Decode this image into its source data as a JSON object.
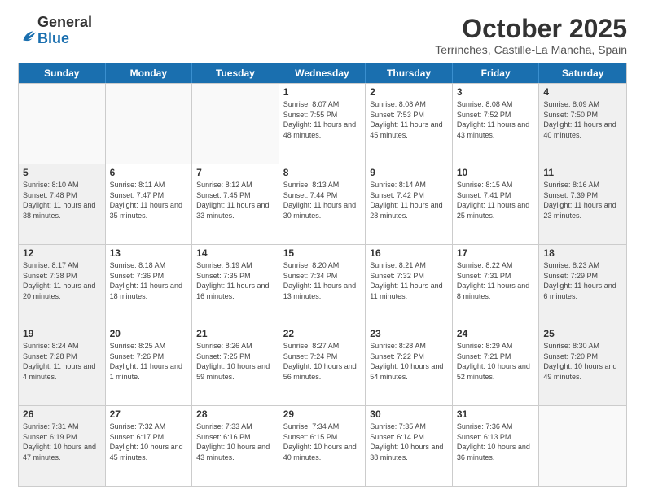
{
  "header": {
    "logo_general": "General",
    "logo_blue": "Blue",
    "month_title": "October 2025",
    "location": "Terrinches, Castille-La Mancha, Spain"
  },
  "days_of_week": [
    "Sunday",
    "Monday",
    "Tuesday",
    "Wednesday",
    "Thursday",
    "Friday",
    "Saturday"
  ],
  "weeks": [
    [
      {
        "day": "",
        "info": "",
        "empty": true
      },
      {
        "day": "",
        "info": "",
        "empty": true
      },
      {
        "day": "",
        "info": "",
        "empty": true
      },
      {
        "day": "1",
        "info": "Sunrise: 8:07 AM\nSunset: 7:55 PM\nDaylight: 11 hours\nand 48 minutes."
      },
      {
        "day": "2",
        "info": "Sunrise: 8:08 AM\nSunset: 7:53 PM\nDaylight: 11 hours\nand 45 minutes."
      },
      {
        "day": "3",
        "info": "Sunrise: 8:08 AM\nSunset: 7:52 PM\nDaylight: 11 hours\nand 43 minutes."
      },
      {
        "day": "4",
        "info": "Sunrise: 8:09 AM\nSunset: 7:50 PM\nDaylight: 11 hours\nand 40 minutes.",
        "shaded": true
      }
    ],
    [
      {
        "day": "5",
        "info": "Sunrise: 8:10 AM\nSunset: 7:48 PM\nDaylight: 11 hours\nand 38 minutes.",
        "shaded": true
      },
      {
        "day": "6",
        "info": "Sunrise: 8:11 AM\nSunset: 7:47 PM\nDaylight: 11 hours\nand 35 minutes."
      },
      {
        "day": "7",
        "info": "Sunrise: 8:12 AM\nSunset: 7:45 PM\nDaylight: 11 hours\nand 33 minutes."
      },
      {
        "day": "8",
        "info": "Sunrise: 8:13 AM\nSunset: 7:44 PM\nDaylight: 11 hours\nand 30 minutes."
      },
      {
        "day": "9",
        "info": "Sunrise: 8:14 AM\nSunset: 7:42 PM\nDaylight: 11 hours\nand 28 minutes."
      },
      {
        "day": "10",
        "info": "Sunrise: 8:15 AM\nSunset: 7:41 PM\nDaylight: 11 hours\nand 25 minutes."
      },
      {
        "day": "11",
        "info": "Sunrise: 8:16 AM\nSunset: 7:39 PM\nDaylight: 11 hours\nand 23 minutes.",
        "shaded": true
      }
    ],
    [
      {
        "day": "12",
        "info": "Sunrise: 8:17 AM\nSunset: 7:38 PM\nDaylight: 11 hours\nand 20 minutes.",
        "shaded": true
      },
      {
        "day": "13",
        "info": "Sunrise: 8:18 AM\nSunset: 7:36 PM\nDaylight: 11 hours\nand 18 minutes."
      },
      {
        "day": "14",
        "info": "Sunrise: 8:19 AM\nSunset: 7:35 PM\nDaylight: 11 hours\nand 16 minutes."
      },
      {
        "day": "15",
        "info": "Sunrise: 8:20 AM\nSunset: 7:34 PM\nDaylight: 11 hours\nand 13 minutes."
      },
      {
        "day": "16",
        "info": "Sunrise: 8:21 AM\nSunset: 7:32 PM\nDaylight: 11 hours\nand 11 minutes."
      },
      {
        "day": "17",
        "info": "Sunrise: 8:22 AM\nSunset: 7:31 PM\nDaylight: 11 hours\nand 8 minutes."
      },
      {
        "day": "18",
        "info": "Sunrise: 8:23 AM\nSunset: 7:29 PM\nDaylight: 11 hours\nand 6 minutes.",
        "shaded": true
      }
    ],
    [
      {
        "day": "19",
        "info": "Sunrise: 8:24 AM\nSunset: 7:28 PM\nDaylight: 11 hours\nand 4 minutes.",
        "shaded": true
      },
      {
        "day": "20",
        "info": "Sunrise: 8:25 AM\nSunset: 7:26 PM\nDaylight: 11 hours\nand 1 minute."
      },
      {
        "day": "21",
        "info": "Sunrise: 8:26 AM\nSunset: 7:25 PM\nDaylight: 10 hours\nand 59 minutes."
      },
      {
        "day": "22",
        "info": "Sunrise: 8:27 AM\nSunset: 7:24 PM\nDaylight: 10 hours\nand 56 minutes."
      },
      {
        "day": "23",
        "info": "Sunrise: 8:28 AM\nSunset: 7:22 PM\nDaylight: 10 hours\nand 54 minutes."
      },
      {
        "day": "24",
        "info": "Sunrise: 8:29 AM\nSunset: 7:21 PM\nDaylight: 10 hours\nand 52 minutes."
      },
      {
        "day": "25",
        "info": "Sunrise: 8:30 AM\nSunset: 7:20 PM\nDaylight: 10 hours\nand 49 minutes.",
        "shaded": true
      }
    ],
    [
      {
        "day": "26",
        "info": "Sunrise: 7:31 AM\nSunset: 6:19 PM\nDaylight: 10 hours\nand 47 minutes.",
        "shaded": true
      },
      {
        "day": "27",
        "info": "Sunrise: 7:32 AM\nSunset: 6:17 PM\nDaylight: 10 hours\nand 45 minutes."
      },
      {
        "day": "28",
        "info": "Sunrise: 7:33 AM\nSunset: 6:16 PM\nDaylight: 10 hours\nand 43 minutes."
      },
      {
        "day": "29",
        "info": "Sunrise: 7:34 AM\nSunset: 6:15 PM\nDaylight: 10 hours\nand 40 minutes."
      },
      {
        "day": "30",
        "info": "Sunrise: 7:35 AM\nSunset: 6:14 PM\nDaylight: 10 hours\nand 38 minutes."
      },
      {
        "day": "31",
        "info": "Sunrise: 7:36 AM\nSunset: 6:13 PM\nDaylight: 10 hours\nand 36 minutes."
      },
      {
        "day": "",
        "info": "",
        "empty": true,
        "shaded": true
      }
    ]
  ]
}
